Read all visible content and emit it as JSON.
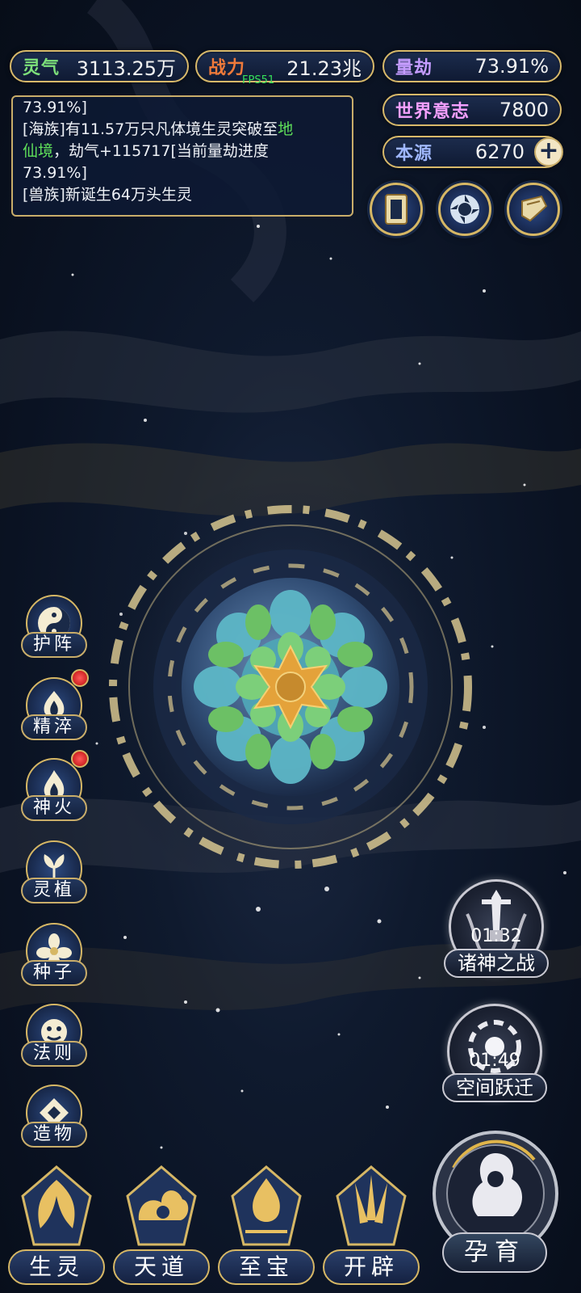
{
  "resources": {
    "lingqi": {
      "label": "灵气",
      "value": "3113.25万"
    },
    "zhanli": {
      "label": "战力",
      "value": "21.23兆"
    },
    "liangjie": {
      "label": "量劫",
      "value": "73.91%"
    },
    "shijie": {
      "label": "世界意志",
      "value": "7800"
    },
    "benyuan": {
      "label": "本源",
      "value": "6270"
    }
  },
  "fps": "FPS51",
  "log": {
    "line1": "73.91%]",
    "line2_a": "[海族]有11.57万只凡体境生灵突破至",
    "line2_highlight_1": "地",
    "line3_highlight": "仙境",
    "line3_b": "，劫气+115717[当前量劫进度",
    "line4": "73.91%]",
    "line5": "[兽族]新诞生64万头生灵"
  },
  "side_buttons": [
    {
      "label": "护阵",
      "badge": false
    },
    {
      "label": "精淬",
      "badge": true
    },
    {
      "label": "神火",
      "badge": true
    },
    {
      "label": "灵植",
      "badge": false
    },
    {
      "label": "种子",
      "badge": false
    },
    {
      "label": "法则",
      "badge": false
    },
    {
      "label": "造物",
      "badge": false
    }
  ],
  "events": [
    {
      "label": "诸神之战",
      "timer": "01:32"
    },
    {
      "label": "空间跃迁",
      "timer": "01:49"
    }
  ],
  "bottom_nav": [
    {
      "label": "生灵"
    },
    {
      "label": "天道"
    },
    {
      "label": "至宝"
    },
    {
      "label": "开辟"
    }
  ],
  "main_action": {
    "label": "孕育"
  },
  "colors": {
    "gold": "#d6b765",
    "accent_green": "#5fe05a",
    "badge_red": "#d42020"
  }
}
